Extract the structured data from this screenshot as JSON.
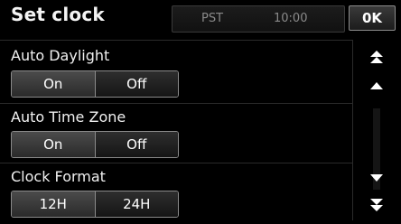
{
  "header": {
    "title": "Set clock",
    "timezone": "PST",
    "time": "10:00",
    "ok_label": "0K"
  },
  "settings": [
    {
      "label": "Auto Daylight",
      "options": [
        "On",
        "Off"
      ]
    },
    {
      "label": "Auto Time Zone",
      "options": [
        "On",
        "Off"
      ]
    },
    {
      "label": "Clock Format",
      "options": [
        "12H",
        "24H"
      ]
    }
  ],
  "scroll": {
    "icons": [
      "page-up-icon",
      "line-up-icon",
      "line-down-icon",
      "page-down-icon"
    ]
  }
}
